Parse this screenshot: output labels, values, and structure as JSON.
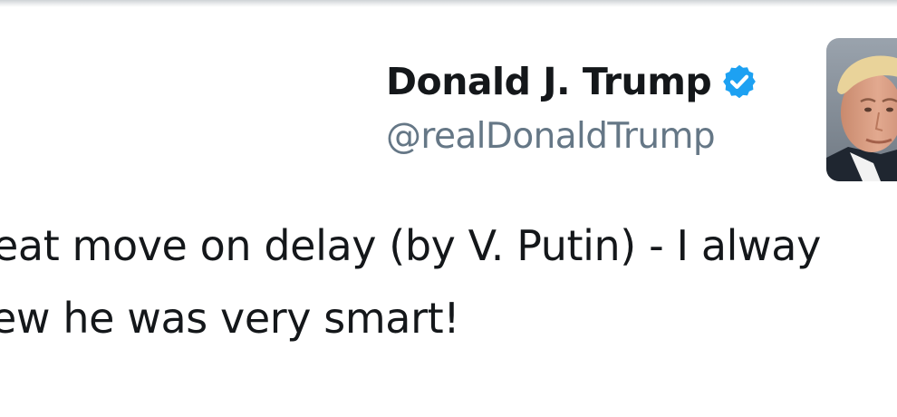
{
  "author": {
    "display_name": "Donald J. Trump",
    "handle": "@realDonaldTrump",
    "verified": true,
    "verified_badge_icon": "verified-badge-icon",
    "avatar_icon": "profile-photo"
  },
  "tweet": {
    "line1": "eat move on delay (by V. Putin) - I alway",
    "line2": "ew he was very smart!"
  },
  "colors": {
    "text": "#14171a",
    "handle": "#657786",
    "verified": "#1da1f2",
    "background": "#ffffff"
  }
}
